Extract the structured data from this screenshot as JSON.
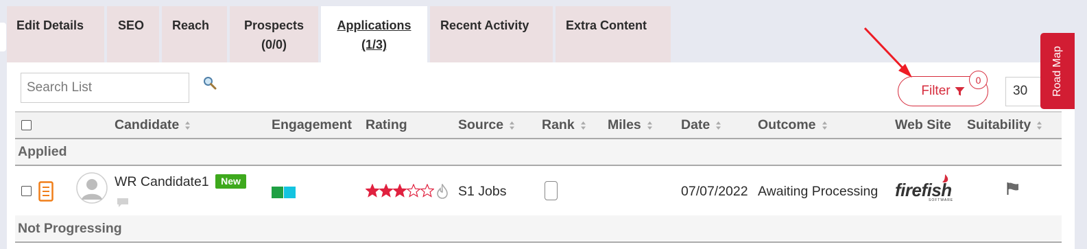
{
  "tabs": [
    {
      "line1": "Edit Details",
      "line2": ""
    },
    {
      "line1": "SEO",
      "line2": ""
    },
    {
      "line1": "Reach",
      "line2": ""
    },
    {
      "line1": "Prospects",
      "line2": "(0/0)"
    },
    {
      "line1": "Applications",
      "line2": "(1/3)"
    },
    {
      "line1": "Recent Activity",
      "line2": ""
    },
    {
      "line1": "Extra Content",
      "line2": ""
    }
  ],
  "active_tab": "Applications",
  "toolbar": {
    "search_placeholder": "Search List",
    "filter_label": "Filter",
    "filter_count": "0",
    "page_size": "30",
    "roadmap_label": "Road Map"
  },
  "columns": {
    "candidate": "Candidate",
    "engagement": "Engagement",
    "rating": "Rating",
    "source": "Source",
    "rank": "Rank",
    "miles": "Miles",
    "date": "Date",
    "outcome": "Outcome",
    "website": "Web Site",
    "suitability": "Suitability"
  },
  "groups": {
    "applied": "Applied",
    "not_progressing": "Not Progressing"
  },
  "rows": [
    {
      "candidate": "WR Candidate1",
      "badge": "New",
      "engagement_colors": [
        "#1fa043",
        "#14c4e0"
      ],
      "rating": 3,
      "rating_max": 5,
      "source": "S1 Jobs",
      "miles": "",
      "date": "07/07/2022",
      "outcome": "Awaiting Processing",
      "website_logo": "firefish",
      "website_logo_sub": "SOFTWARE"
    }
  ],
  "colors": {
    "accent": "#d62b3c",
    "roadmap": "#d21d33",
    "tab_inactive": "#ecdfe1",
    "new_badge": "#3ea91d",
    "resume_icon": "#f07f1a",
    "star": "#e0213f"
  },
  "icons": [
    "search-icon",
    "filter-funnel-icon",
    "sort-icon",
    "resume-document-icon",
    "avatar-icon",
    "comment-icon",
    "star-icon",
    "flame-icon",
    "flag-icon",
    "firefish-logo"
  ]
}
